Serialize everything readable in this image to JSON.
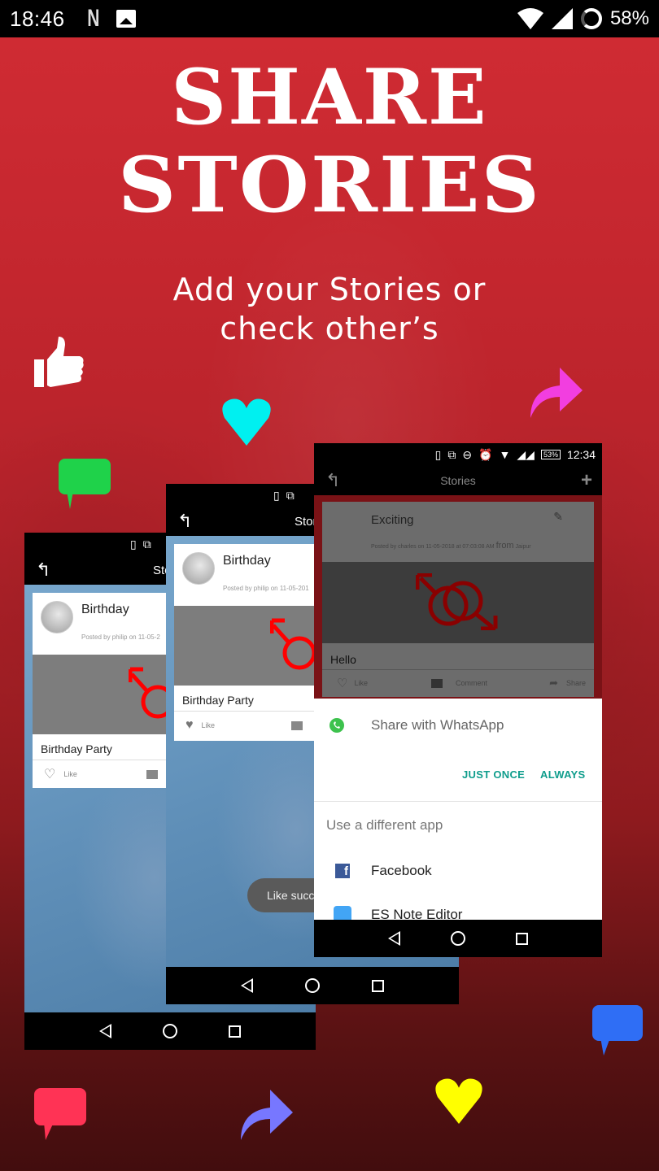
{
  "status_bar": {
    "time": "18:46",
    "notif_icons": [
      "netflix-icon",
      "gallery-icon"
    ],
    "right_icons": [
      "wifi-icon",
      "signal-icon",
      "battery-ring-icon"
    ],
    "battery": "58%"
  },
  "promo": {
    "headline_line1": "SHARE",
    "headline_line2": "STORIES",
    "subtitle_line1": "Add your Stories or",
    "subtitle_line2": "check other’s"
  },
  "decor_icons": [
    {
      "name": "thumbs-up-icon",
      "color": "#ffffff"
    },
    {
      "name": "heart-icon",
      "color": "#00f0f0"
    },
    {
      "name": "share-arrow-icon",
      "color": "#f23ee0"
    },
    {
      "name": "chat-bubble-icon",
      "color": "#1fd24a"
    },
    {
      "name": "chat-bubble-icon",
      "color": "#2f6ef5"
    },
    {
      "name": "chat-bubble-icon",
      "color": "#ff3355"
    },
    {
      "name": "share-arrow-icon",
      "color": "#7777ff"
    },
    {
      "name": "heart-icon",
      "color": "#ffff00"
    }
  ],
  "phones": [
    {
      "toolbar_title": "Sto",
      "card": {
        "title": "Birthday",
        "meta": "Posted by  philip  on  11-05-2",
        "caption": "Birthday Party",
        "like": "Like"
      }
    },
    {
      "toolbar_title": "Stor",
      "card": {
        "title": "Birthday",
        "meta": "Posted by  philip  on  11-05-201",
        "caption": "Birthday Party",
        "like": "Like"
      },
      "toast": "Like succ"
    },
    {
      "status_time": "12:34",
      "status_battery": "53%",
      "toolbar_title": "Stories",
      "card": {
        "title": "Exciting",
        "meta_prefix": "Posted by  charles  on  11-05-2018  at  07:03:08 AM",
        "meta_from": "from",
        "meta_place": "Jaipur",
        "caption": "Hello",
        "like": "Like",
        "comment": "Comment",
        "share": "Share"
      },
      "share_sheet": {
        "title": "Share with WhatsApp",
        "just_once": "JUST ONCE",
        "always": "ALWAYS",
        "other_header": "Use a different app",
        "apps": [
          "Facebook",
          "ES Note Editor"
        ]
      }
    }
  ],
  "colors": {
    "accent_teal": "#0f9d8c",
    "brand_red": "#c3262e"
  }
}
